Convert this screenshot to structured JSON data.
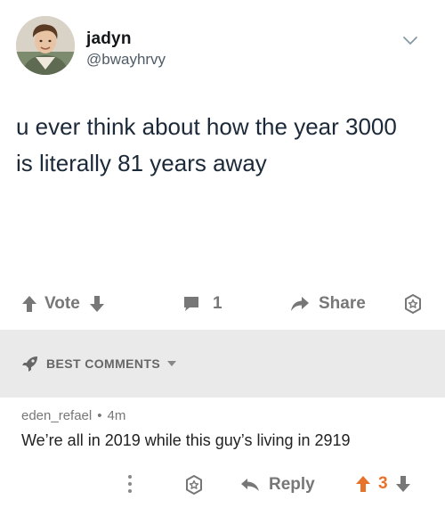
{
  "tweet": {
    "display_name": "jadyn",
    "handle": "@bwayhrvy",
    "text_line1": "u ever think about how the year 3000",
    "text_line2": "is literally 81 years away",
    "icons": {
      "avatar": "profile-photo",
      "menu": "chevron-down-icon"
    }
  },
  "actions": {
    "vote_label": "Vote",
    "comment_count": "1",
    "share_label": "Share",
    "icons": [
      "arrow-up-icon",
      "arrow-down-icon",
      "comment-bubble-icon",
      "share-arrow-icon",
      "star-badge-icon"
    ]
  },
  "best_comments": {
    "label": "BEST COMMENTS",
    "icons": [
      "rocket-icon",
      "caret-down-icon"
    ]
  },
  "comment": {
    "author": "eden_refael",
    "separator": "•",
    "age": "4m",
    "text": "We’re all in 2019 while this guy’s living in 2919",
    "reply_label": "Reply",
    "score": "3",
    "score_color": "#e8732a",
    "icons": [
      "more-vertical-icon",
      "star-badge-icon",
      "reply-arrow-icon",
      "arrow-up-icon",
      "arrow-down-icon"
    ]
  },
  "colors": {
    "background": "#ffffff",
    "best_bar": "#eaeaea",
    "muted_text": "#777777",
    "upvote_active": "#e8732a"
  }
}
